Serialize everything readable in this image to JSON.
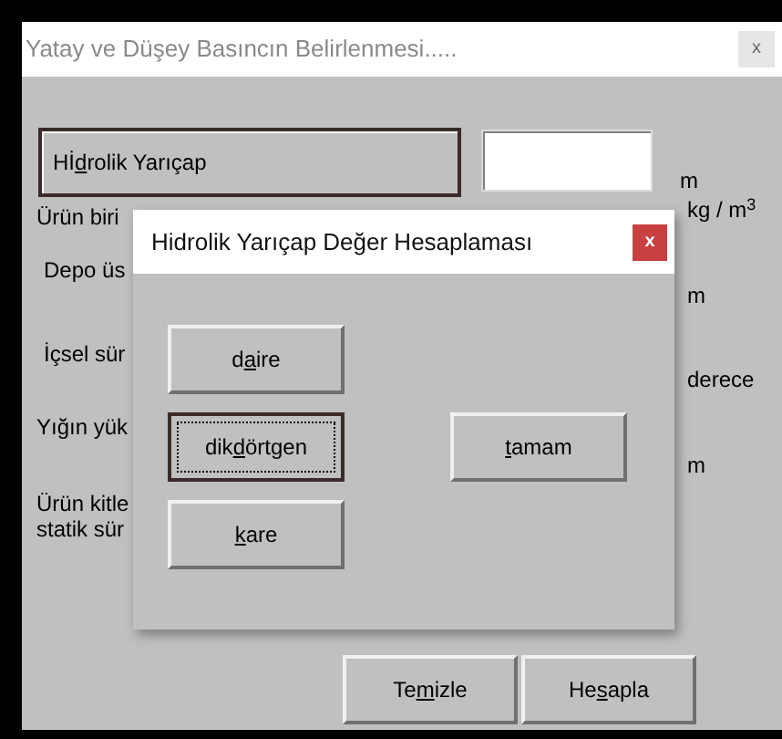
{
  "window": {
    "title": "Yatay ve Düşey Basıncın Belirlenmesi.....",
    "close": "x"
  },
  "main_button": {
    "before": "Hİ",
    "key": "d",
    "after": "rolik Yarıçap"
  },
  "labels": [
    "Ürün biri",
    "Depo üs",
    "İçsel sür",
    "Yığın yük",
    "Ürün kitle",
    "statik sür"
  ],
  "units": [
    "kg / m$^{3}$",
    "m",
    "derece",
    "m"
  ],
  "first_unit": "m",
  "bottom_buttons": [
    {
      "before": "Te",
      "key": "m",
      "after": "izle"
    },
    {
      "before": "He",
      "key": "s",
      "after": "apla"
    }
  ],
  "dialog": {
    "title": "Hidrolik Yarıçap Değer Hesaplaması",
    "close": "x",
    "shape_buttons": [
      {
        "before": "d",
        "key": "a",
        "after": "ire",
        "focused": false
      },
      {
        "before": "dik",
        "key": "d",
        "after": "örtgen",
        "focused": true
      },
      {
        "key": "k",
        "after": "are",
        "focused": false
      }
    ],
    "ok_button": {
      "key": "t",
      "after": "amam",
      "focused": false
    }
  }
}
